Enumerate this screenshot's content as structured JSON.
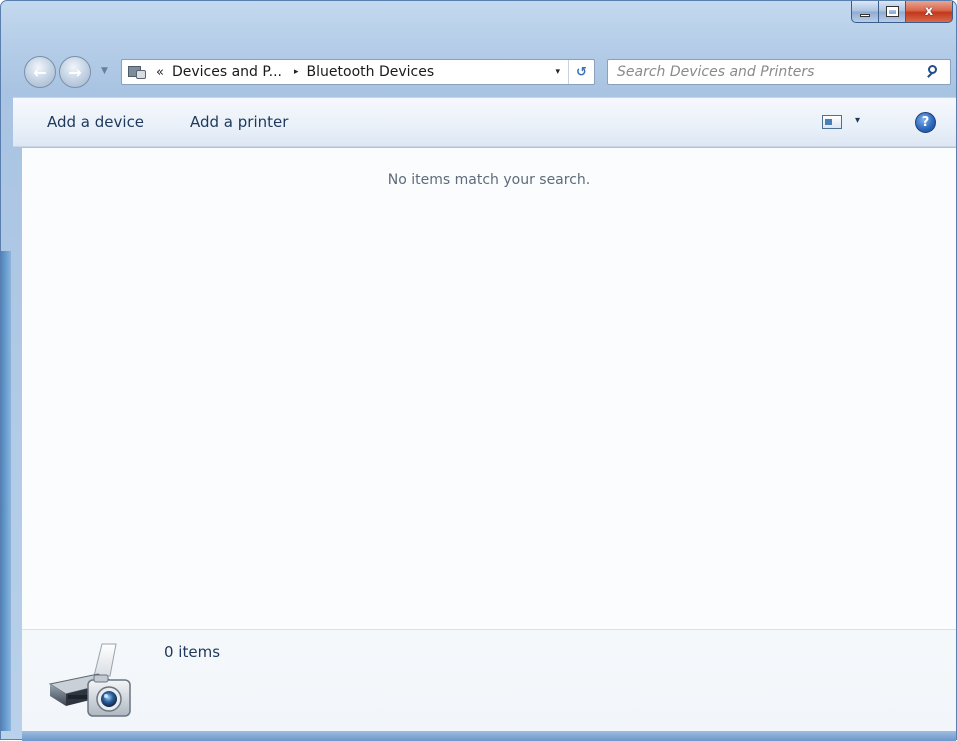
{
  "window": {
    "caption_buttons": {
      "minimize_icon": "minimize-icon",
      "maximize_icon": "maximize-icon",
      "close_glyph": "x"
    }
  },
  "navigation": {
    "back_icon": "back-arrow-icon",
    "forward_icon": "forward-arrow-icon",
    "history_icon": "chevron-down-icon"
  },
  "address_bar": {
    "chevron": "«",
    "breadcrumbs": [
      "Devices and P...",
      "Bluetooth Devices"
    ],
    "separator": "▸",
    "dropdown": "▾",
    "refresh_icon": "refresh-icon"
  },
  "search": {
    "placeholder": "Search Devices and Printers",
    "value": ""
  },
  "command_bar": {
    "add_device": "Add a device",
    "add_printer": "Add a printer",
    "view_dropdown": "▾",
    "help": "?"
  },
  "content": {
    "empty_message": "No items match your search."
  },
  "details_pane": {
    "item_count": "0 items",
    "icon": "devices-and-printers-icon"
  },
  "colors": {
    "frame": "#b5cde8",
    "command_bar_text": "#1e395b",
    "empty_text": "#5d6b7b",
    "close_button": "#c2381b"
  }
}
